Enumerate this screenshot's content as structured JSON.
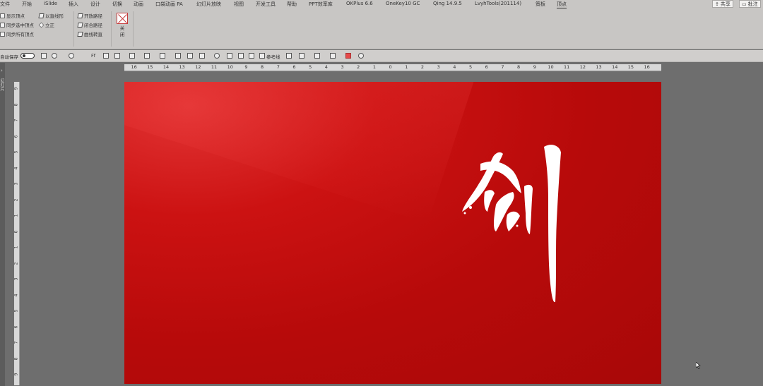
{
  "tabs": [
    {
      "label": "文件"
    },
    {
      "label": "开始"
    },
    {
      "label": "iSlide"
    },
    {
      "label": "插入"
    },
    {
      "label": "设计"
    },
    {
      "label": "切换"
    },
    {
      "label": "动画"
    },
    {
      "label": "口袋动画 PA"
    },
    {
      "label": "幻灯片放映"
    },
    {
      "label": "视图"
    },
    {
      "label": "开发工具"
    },
    {
      "label": "帮助"
    },
    {
      "label": "PPT效率库"
    },
    {
      "label": "OKPlus 6.6"
    },
    {
      "label": "OneKey10 GC"
    },
    {
      "label": "Qing 14.9.5"
    },
    {
      "label": "LvyhTools(201114)"
    },
    {
      "label": "策板"
    },
    {
      "label": "顶点"
    }
  ],
  "window_buttons": {
    "share": "共享",
    "comment": "批注"
  },
  "ribbon": {
    "group1": {
      "show_vertices": "显示顶点",
      "sync_selected": "同步选中顶点",
      "sync_all": "同步所有顶点"
    },
    "group2": {
      "straight_seg": "以直线形",
      "smooth": "立正"
    },
    "group3": {
      "open_path": "开放路径",
      "close_path": "闭合路径",
      "curve_reverse": "曲线转直"
    },
    "close": {
      "label_top": "关",
      "label_bottom": "闭"
    }
  },
  "qat": {
    "autosave": "自动保存",
    "reference": "参考线",
    "font_label": "Ff"
  },
  "panel": {
    "collapsed_label": "幻灯片"
  },
  "rulers": {
    "horizontal": [
      "16",
      "15",
      "14",
      "13",
      "12",
      "11",
      "10",
      "9",
      "8",
      "7",
      "6",
      "5",
      "4",
      "3",
      "2",
      "1",
      "0",
      "1",
      "2",
      "3",
      "4",
      "5",
      "6",
      "7",
      "8",
      "9",
      "10",
      "11",
      "12",
      "13",
      "14",
      "15",
      "16"
    ],
    "vertical": [
      "9",
      "8",
      "7",
      "6",
      "5",
      "4",
      "3",
      "2",
      "1",
      "0",
      "1",
      "2",
      "3",
      "4",
      "5",
      "6",
      "7",
      "8",
      "9"
    ]
  },
  "colors": {
    "slide_red": "#b70a0a",
    "text_white": "#ffffff",
    "ribbon_bg": "#c8c6c4",
    "workspace_bg": "#6e6e6e"
  }
}
